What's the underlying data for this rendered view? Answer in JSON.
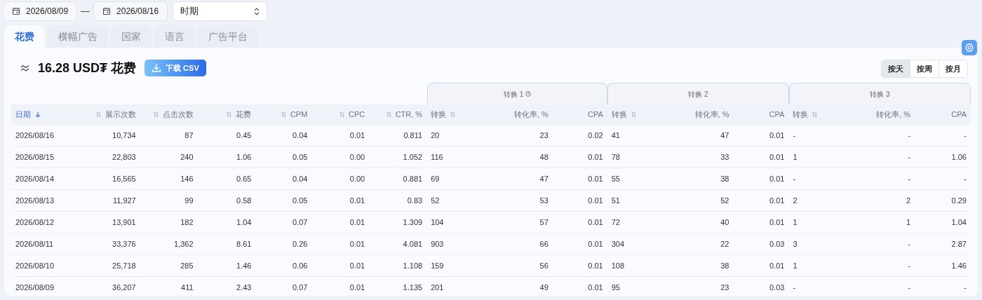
{
  "date_range": {
    "start": "2026/08/09",
    "separator": "—",
    "end": "2026/08/16"
  },
  "period_select": {
    "value": "时期"
  },
  "tabs": [
    {
      "label": "花费",
      "selected": true
    },
    {
      "label": "横幅广告",
      "selected": false
    },
    {
      "label": "国家",
      "selected": false
    },
    {
      "label": "语言",
      "selected": false
    },
    {
      "label": "广告平台",
      "selected": false
    }
  ],
  "summary": {
    "title": "16.28 USD₮ 花费",
    "download_button": "下载 CSV"
  },
  "granularity": [
    {
      "label": "按天",
      "selected": true
    },
    {
      "label": "按周",
      "selected": false
    },
    {
      "label": "按月",
      "selected": false
    }
  ],
  "table": {
    "groups": [
      {
        "label": "转换 1",
        "help": true
      },
      {
        "label": "转换 2",
        "help": false
      },
      {
        "label": "转换 3",
        "help": false
      }
    ],
    "columns": [
      {
        "label": "日期",
        "kind": "date",
        "sortable": true,
        "sorted": true
      },
      {
        "label": "展示次数",
        "kind": "number",
        "sortable": true,
        "sorted": false
      },
      {
        "label": "点击次数",
        "kind": "number",
        "sortable": true,
        "sorted": false
      },
      {
        "label": "花费",
        "kind": "number",
        "sortable": true,
        "sorted": false
      },
      {
        "label": "CPM",
        "kind": "number",
        "sortable": true,
        "sorted": false
      },
      {
        "label": "CPC",
        "kind": "number",
        "sortable": true,
        "sorted": false
      },
      {
        "label": "CTR, %",
        "kind": "number",
        "sortable": true,
        "sorted": false
      },
      {
        "label": "转换",
        "kind": "count",
        "sortable": true,
        "sorted": false
      },
      {
        "label": "转化率, %",
        "kind": "number",
        "sortable": false,
        "sorted": false
      },
      {
        "label": "CPA",
        "kind": "number",
        "sortable": false,
        "sorted": false
      },
      {
        "label": "转换",
        "kind": "count",
        "sortable": true,
        "sorted": false
      },
      {
        "label": "转化率, %",
        "kind": "number",
        "sortable": false,
        "sorted": false
      },
      {
        "label": "CPA",
        "kind": "number",
        "sortable": false,
        "sorted": false
      },
      {
        "label": "转换",
        "kind": "count",
        "sortable": true,
        "sorted": false
      },
      {
        "label": "转化率, %",
        "kind": "number",
        "sortable": false,
        "sorted": false
      },
      {
        "label": "CPA",
        "kind": "number",
        "sortable": false,
        "sorted": false
      }
    ],
    "rows": [
      [
        "2026/08/16",
        "10,734",
        "87",
        "0.45",
        "0.04",
        "0.01",
        "0.811",
        "20",
        "23",
        "0.02",
        "41",
        "47",
        "0.01",
        "-",
        "-",
        "-"
      ],
      [
        "2026/08/15",
        "22,803",
        "240",
        "1.06",
        "0.05",
        "0.00",
        "1.052",
        "116",
        "48",
        "0.01",
        "78",
        "33",
        "0.01",
        "1",
        "-",
        "1.06"
      ],
      [
        "2026/08/14",
        "16,565",
        "146",
        "0.65",
        "0.04",
        "0.00",
        "0.881",
        "69",
        "47",
        "0.01",
        "55",
        "38",
        "0.01",
        "-",
        "-",
        "-"
      ],
      [
        "2026/08/13",
        "11,927",
        "99",
        "0.58",
        "0.05",
        "0.01",
        "0.83",
        "52",
        "53",
        "0.01",
        "51",
        "52",
        "0.01",
        "2",
        "2",
        "0.29"
      ],
      [
        "2026/08/12",
        "13,901",
        "182",
        "1.04",
        "0.07",
        "0.01",
        "1.309",
        "104",
        "57",
        "0.01",
        "72",
        "40",
        "0.01",
        "1",
        "1",
        "1.04"
      ],
      [
        "2026/08/11",
        "33,376",
        "1,362",
        "8.61",
        "0.26",
        "0.01",
        "4.081",
        "903",
        "66",
        "0.01",
        "304",
        "22",
        "0.03",
        "3",
        "-",
        "2.87"
      ],
      [
        "2026/08/10",
        "25,718",
        "285",
        "1.46",
        "0.06",
        "0.01",
        "1.108",
        "159",
        "56",
        "0.01",
        "108",
        "38",
        "0.01",
        "1",
        "-",
        "1.46"
      ],
      [
        "2026/08/09",
        "36,207",
        "411",
        "2.43",
        "0.07",
        "0.01",
        "1.135",
        "201",
        "49",
        "0.01",
        "95",
        "23",
        "0.03",
        "-",
        "-",
        "-"
      ]
    ]
  }
}
